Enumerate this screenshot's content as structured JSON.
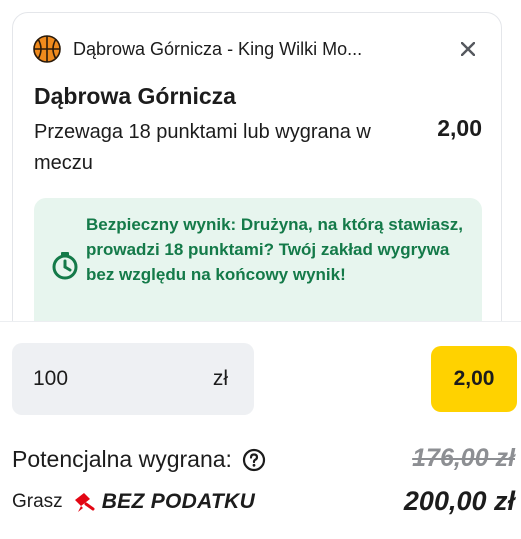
{
  "bet_card": {
    "match_icon": "basketball-icon",
    "match_title": "Dąbrowa Górnicza - King Wilki Mo...",
    "close_icon": "close-icon",
    "team": "Dąbrowa Górnicza",
    "selection": "Przewaga 18 punktami lub wygrana w meczu",
    "odds": "2,00",
    "info": {
      "icon": "stopwatch-icon",
      "text": "Bezpieczny wynik: Drużyna, na którą stawiasz, prowadzi 18 punktami? Twój zakład wygrywa bez względu na końcowy wynik!"
    }
  },
  "stake": {
    "value": "100",
    "currency": "zł"
  },
  "odds_button": "2,00",
  "potential_win": {
    "label": "Potencjalna wygrana:",
    "help_icon": "question-circle-icon",
    "old_amount": "176,00 zł"
  },
  "tax": {
    "prefix": "Grasz",
    "icon": "tax-free-icon",
    "badge": "BEZ PODATKU",
    "total": "200,00 zł"
  },
  "colors": {
    "accent_yellow": "#ffd200",
    "info_bg": "#e7f5ee",
    "info_text": "#147a49",
    "tax_icon": "#e30613"
  }
}
